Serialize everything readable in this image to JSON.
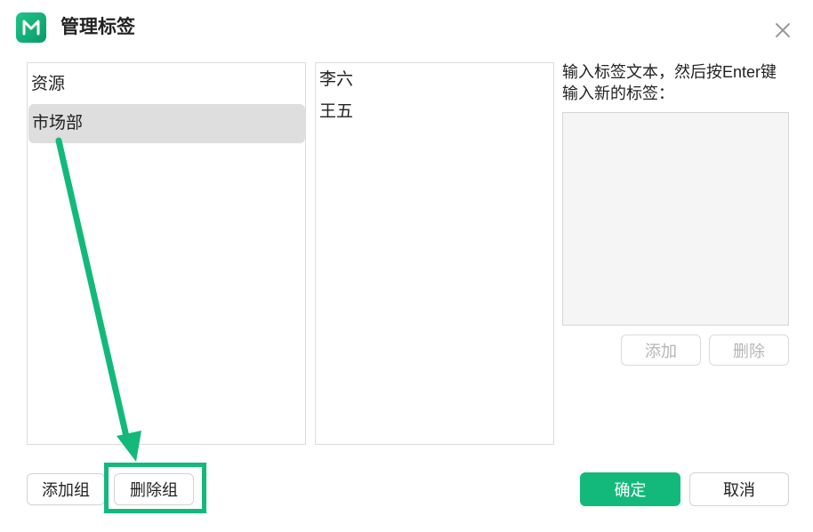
{
  "dialog": {
    "title": "管理标签",
    "logo_icon": "mindmaster-logo-icon",
    "close_icon": "close-icon"
  },
  "groups": {
    "items": [
      {
        "label": "资源",
        "selected": false
      },
      {
        "label": "市场部",
        "selected": true
      }
    ],
    "add_label": "添加组",
    "delete_label": "删除组"
  },
  "tags": {
    "items": [
      "李六",
      "王五"
    ]
  },
  "input": {
    "hint_line1": "输入标签文本，然后按Enter键",
    "hint_line2": "输入新的标签：",
    "value": "",
    "add_label": "添加",
    "delete_label": "删除"
  },
  "footer": {
    "ok_label": "确定",
    "cancel_label": "取消"
  },
  "colors": {
    "accent": "#13b97b",
    "selected_bg": "#dedede"
  }
}
